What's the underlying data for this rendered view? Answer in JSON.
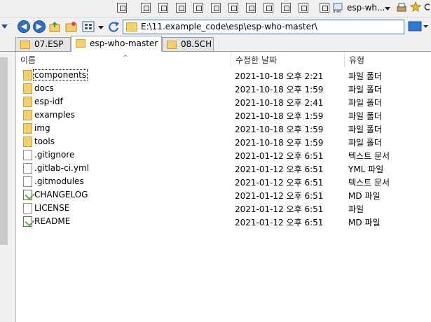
{
  "toolbar": {
    "window_label": "esp-wh..."
  },
  "address": {
    "path": "E:\\11.example_code\\esp\\esp-who-master\\"
  },
  "tabs": [
    {
      "label": "07.ESP"
    },
    {
      "label": "esp-who-master"
    },
    {
      "label": "08.SCH"
    }
  ],
  "columns": {
    "name": "이름",
    "modified": "수정한 날짜",
    "type": "유형"
  },
  "files": [
    {
      "name": "components",
      "date": "2021-10-18 오후 2:21",
      "type": "파일 폴더",
      "icon": "folder-icon"
    },
    {
      "name": "docs",
      "date": "2021-10-18 오후 1:59",
      "type": "파일 폴더",
      "icon": "folder-icon"
    },
    {
      "name": "esp-idf",
      "date": "2021-10-18 오후 2:41",
      "type": "파일 폴더",
      "icon": "folder-icon"
    },
    {
      "name": "examples",
      "date": "2021-10-18 오후 1:59",
      "type": "파일 폴더",
      "icon": "folder-icon"
    },
    {
      "name": "img",
      "date": "2021-10-18 오후 1:59",
      "type": "파일 폴더",
      "icon": "folder-icon"
    },
    {
      "name": "tools",
      "date": "2021-10-18 오후 1:59",
      "type": "파일 폴더",
      "icon": "folder-icon"
    },
    {
      "name": ".gitignore",
      "date": "2021-01-12 오후 6:51",
      "type": "텍스트 문서",
      "icon": "file-icon"
    },
    {
      "name": ".gitlab-ci.yml",
      "date": "2021-01-12 오후 6:51",
      "type": "YML 파일",
      "icon": "file-icon"
    },
    {
      "name": ".gitmodules",
      "date": "2021-01-12 오후 6:51",
      "type": "텍스트 문서",
      "icon": "file-icon"
    },
    {
      "name": "CHANGELOG",
      "date": "2021-01-12 오후 6:51",
      "type": "MD 파일",
      "icon": "md-file-icon"
    },
    {
      "name": "LICENSE",
      "date": "2021-01-12 오후 6:51",
      "type": "파일",
      "icon": "file-icon"
    },
    {
      "name": "README",
      "date": "2021-01-12 오후 6:51",
      "type": "MD 파일",
      "icon": "md-file-icon"
    }
  ]
}
